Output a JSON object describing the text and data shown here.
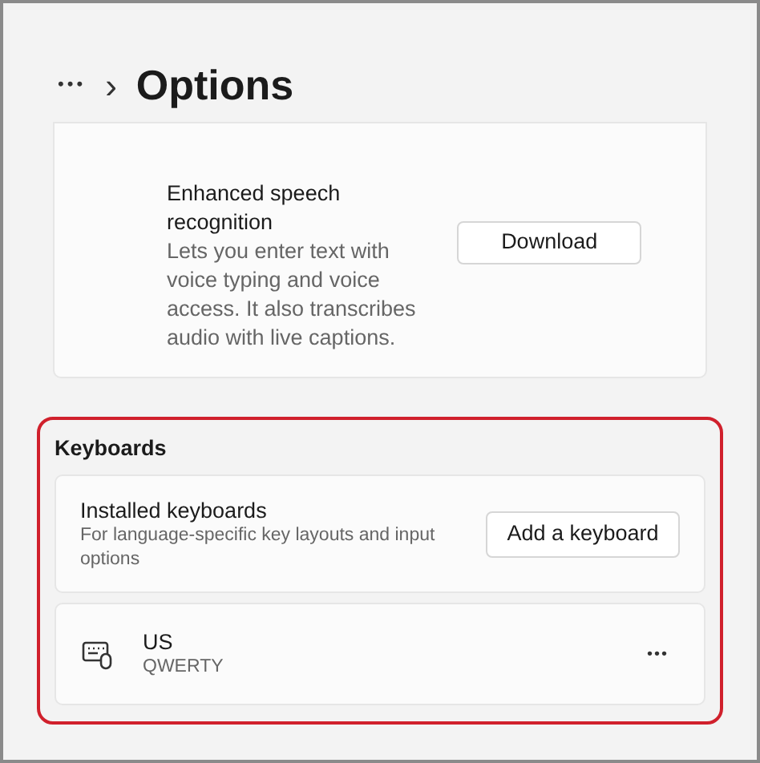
{
  "breadcrumb": {
    "more": "•••",
    "separator": "›",
    "title": "Options"
  },
  "speech": {
    "title": "Enhanced speech recognition",
    "description": "Lets you enter text with voice typing and voice access. It also transcribes audio with live captions.",
    "button": "Download"
  },
  "keyboards": {
    "heading": "Keyboards",
    "installed": {
      "title": "Installed keyboards",
      "description": "For language-specific key layouts and input options",
      "button": "Add a keyboard"
    },
    "items": [
      {
        "name": "US",
        "layout": "QWERTY",
        "more": "•••"
      }
    ]
  }
}
